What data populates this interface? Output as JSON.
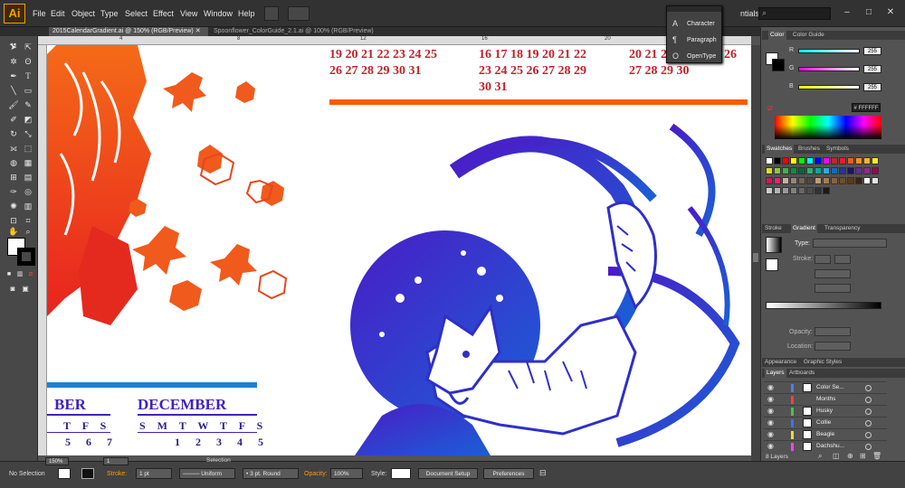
{
  "app": {
    "logo": "Ai"
  },
  "menu": [
    "File",
    "Edit",
    "Object",
    "Type",
    "Select",
    "Effect",
    "View",
    "Window",
    "Help"
  ],
  "workspace_label": "ntials",
  "doc_tabs": [
    {
      "label": "2015CalendarGradient.ai @ 150% (RGB/Preview)"
    },
    {
      "label": "Spoonflower_ColorGuide_2.1.ai @ 100% (RGB/Preview)"
    }
  ],
  "ruler_labels": [
    "4",
    "8",
    "12",
    "16",
    "20"
  ],
  "calendar": {
    "top_dates": [
      "19 20 21 22 23 24 25\n26 27 28 29 30 31",
      "16 17 18 19 20 21 22\n23 24 25 26 27 28 29\n30 31",
      "20 21 22 23 24 25 26\n27 28 29 30"
    ],
    "left_month": "BER",
    "left_dow": "T F S",
    "left_nums": "5 6 7",
    "dec_month": "DECEMBER",
    "dec_dow": "S M T W T F S",
    "dec_nums": "1 2 3 4 5"
  },
  "popup": {
    "items": [
      "Character",
      "Paragraph",
      "OpenType"
    ],
    "icons": [
      "A",
      "¶",
      "O"
    ]
  },
  "color_panel": {
    "tabs": [
      "Color",
      "Color Guide"
    ],
    "labels": [
      "R",
      "G",
      "B"
    ],
    "values": [
      "255",
      "255",
      "255"
    ],
    "hex": "FFFFFF"
  },
  "swatch_tabs": [
    "Swatches",
    "Brushes",
    "Symbols"
  ],
  "swatch_colors": [
    "#ffffff",
    "#000000",
    "#ff0000",
    "#ffff00",
    "#00ff00",
    "#00ffff",
    "#0000ff",
    "#ff00ff",
    "#c1272d",
    "#ed1c24",
    "#f15a24",
    "#f7931e",
    "#fbb03b",
    "#fcee21",
    "#d9e021",
    "#8cc63f",
    "#39b54a",
    "#009245",
    "#006837",
    "#22b573",
    "#00a99d",
    "#29abe2",
    "#0071bc",
    "#2e3192",
    "#1b1464",
    "#662d91",
    "#93278f",
    "#9e005d",
    "#d4145a",
    "#ed1e79",
    "#c7b299",
    "#998675",
    "#736357",
    "#534741",
    "#c69c6d",
    "#a67c52",
    "#8c6239",
    "#754c24",
    "#603813",
    "#42210b",
    "#ffffff",
    "#e6e6e6",
    "#cccccc",
    "#b3b3b3",
    "#999999",
    "#808080",
    "#666666",
    "#4d4d4d",
    "#333333",
    "#1a1a1a"
  ],
  "gradient_panel": {
    "tabs": [
      "Stroke",
      "Gradient",
      "Transparency"
    ],
    "type_label": "Type:",
    "stroke_label": "Stroke:",
    "opacity_label": "Opacity:",
    "location_label": "Location:"
  },
  "appearance_tabs": [
    "Appearance",
    "Graphic Styles"
  ],
  "layers_tabs": [
    "Layers",
    "Artboards"
  ],
  "layers": [
    {
      "name": "Color Se...",
      "color": "#4f7cff"
    },
    {
      "name": "Months",
      "color": "#ff3f3f"
    },
    {
      "name": "Husky",
      "color": "#43c843"
    },
    {
      "name": "Collie",
      "color": "#3f6fff"
    },
    {
      "name": "Beagle",
      "color": "#ffd13f"
    },
    {
      "name": "Dachshu...",
      "color": "#ff3fff"
    }
  ],
  "layers_count": "8 Layers",
  "status": {
    "selection": "No Selection",
    "stroke_label": "Stroke:",
    "stroke_value": "1 pt",
    "uniform": "Uniform",
    "round": "3 pt. Round",
    "opacity_label": "Opacity:",
    "opacity_value": "100%",
    "style_label": "Style:",
    "doc_setup": "Document Setup",
    "prefs": "Preferences",
    "zoom": "150%",
    "artboard": "1",
    "mode": "Selection"
  }
}
